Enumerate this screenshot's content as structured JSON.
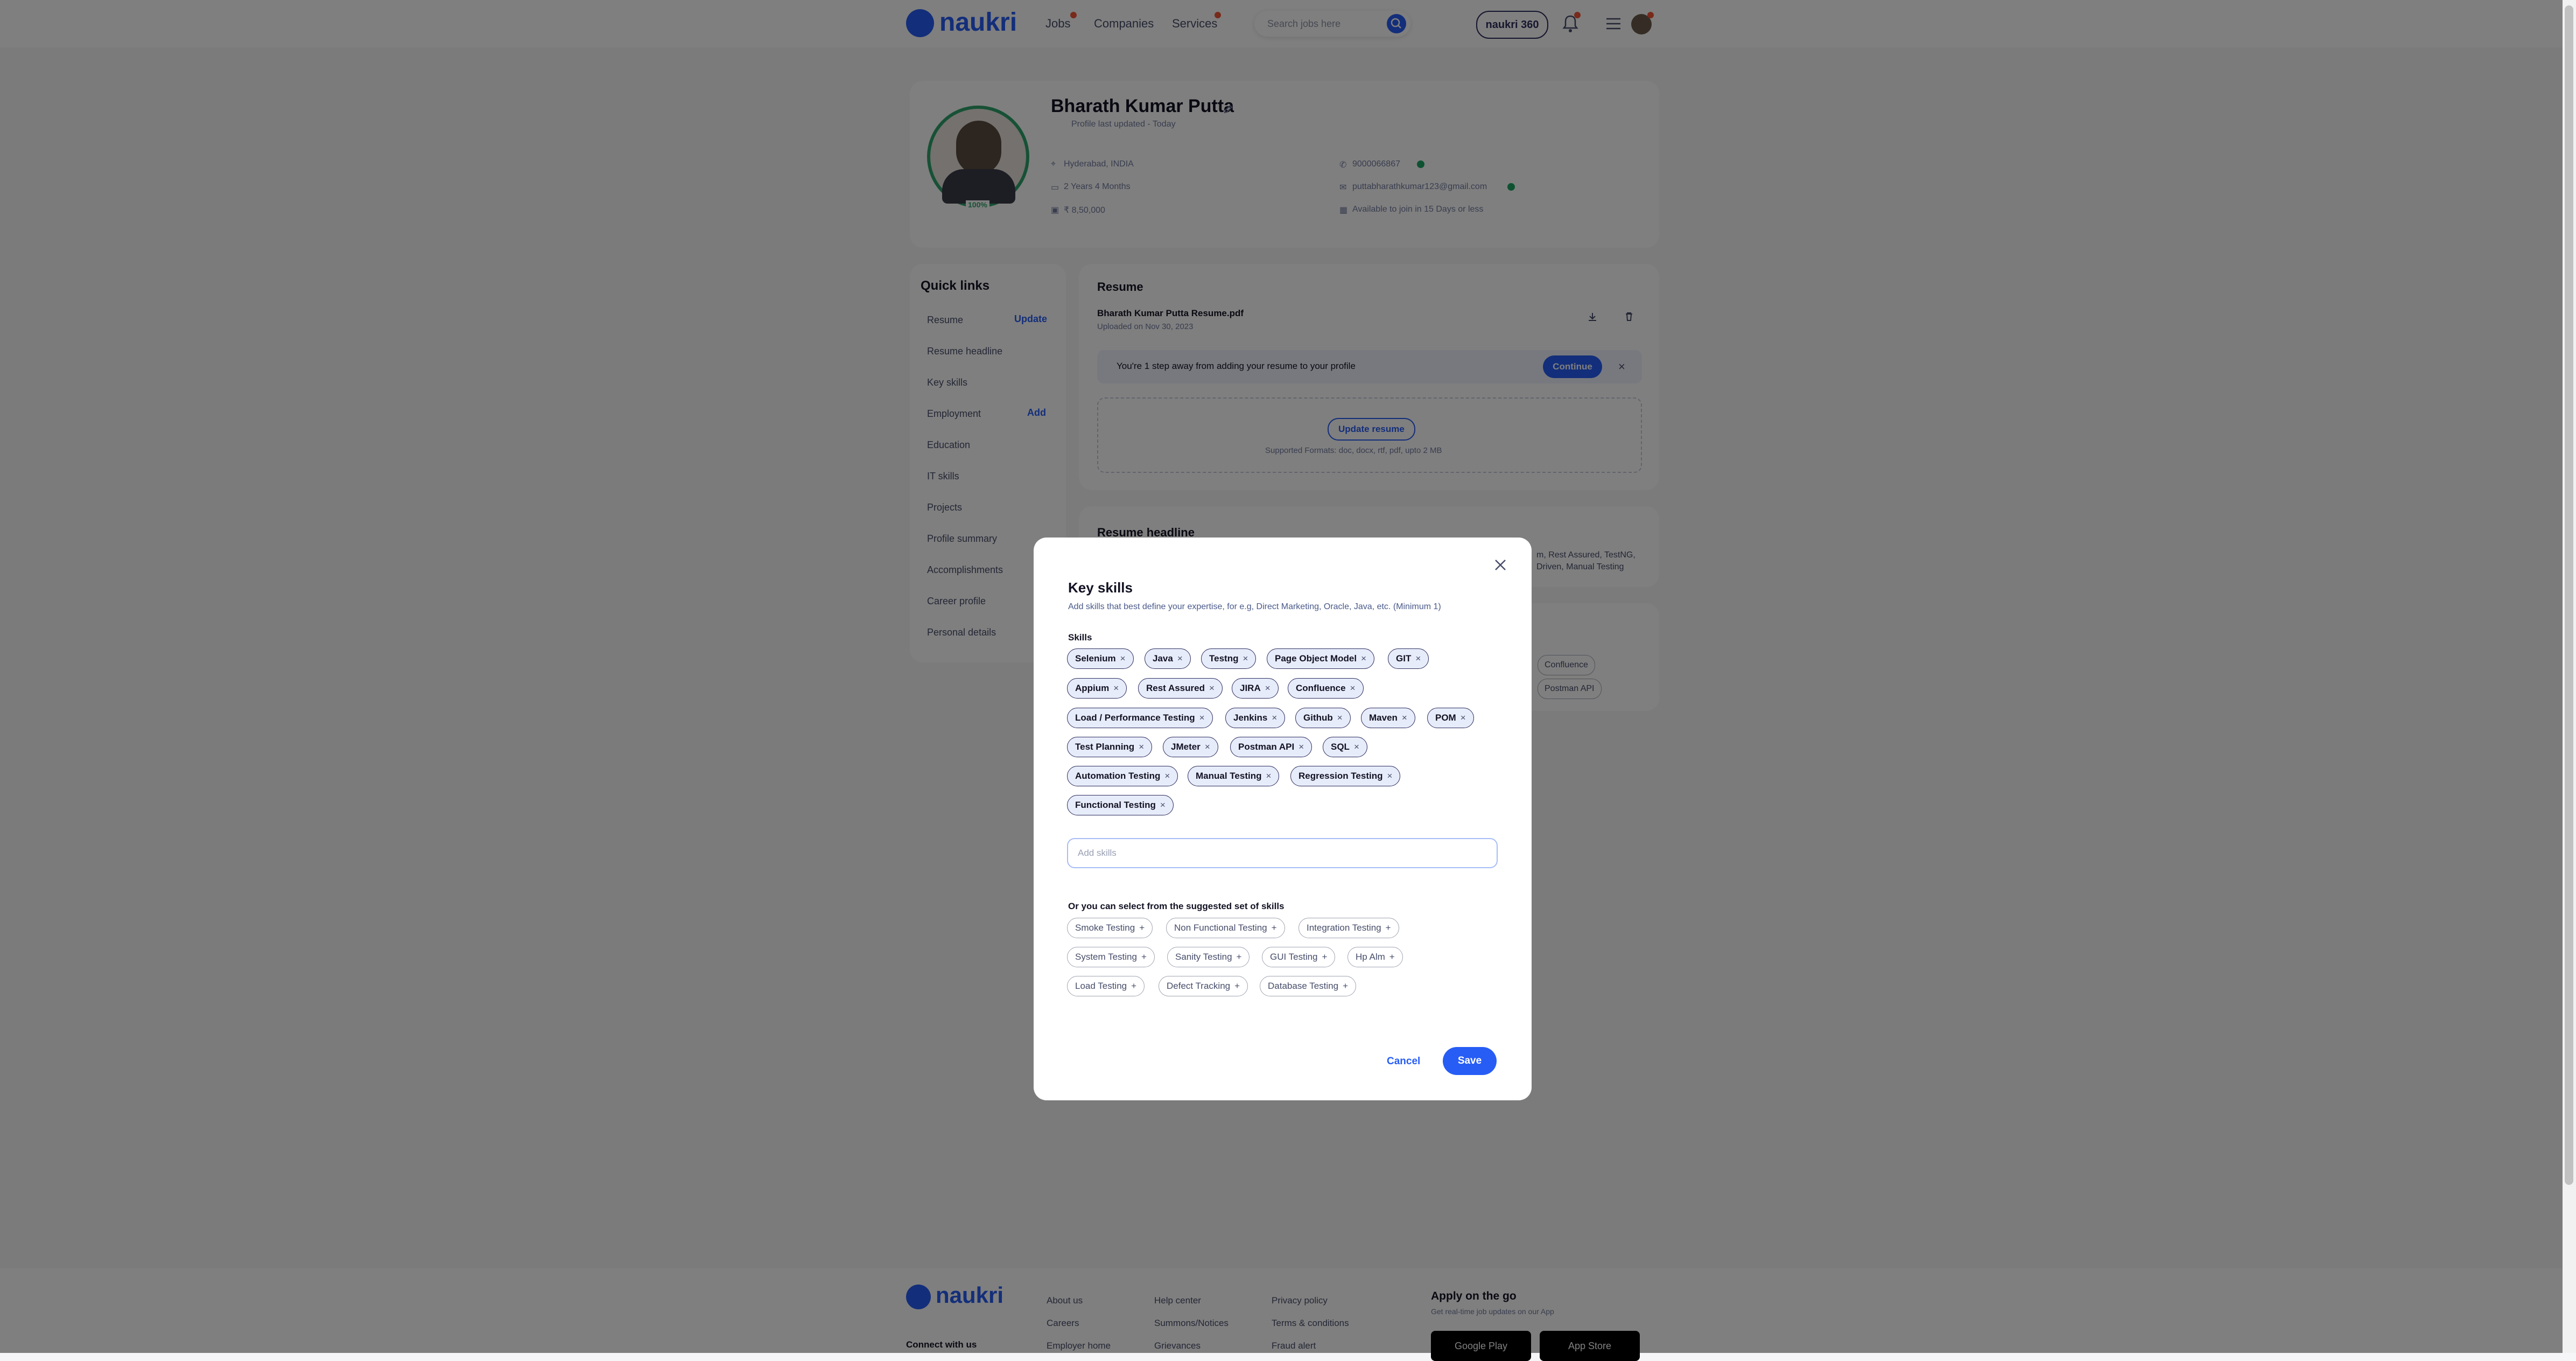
{
  "header": {
    "logo_text": "naukri",
    "nav": [
      "Jobs",
      "Companies",
      "Services"
    ],
    "search_placeholder": "Search jobs here",
    "naukri360": "naukri 360"
  },
  "profile": {
    "name": "Bharath Kumar Putta",
    "updated": "Profile last updated - Today",
    "location": "Hyderabad, INDIA",
    "experience": "2 Years 4 Months",
    "salary": "₹ 8,50,000",
    "phone": "9000066867",
    "email": "puttabharathkumar123@gmail.com",
    "availability": "Available to join in 15 Days or less",
    "completion": "100%"
  },
  "quick_links": {
    "title": "Quick links",
    "items": [
      "Resume",
      "Resume headline",
      "Key skills",
      "Employment",
      "Education",
      "IT skills",
      "Projects",
      "Profile summary",
      "Accomplishments",
      "Career profile",
      "Personal details"
    ],
    "update": "Update",
    "add": "Add"
  },
  "resume": {
    "title": "Resume",
    "file": "Bharath Kumar Putta Resume.pdf",
    "uploaded": "Uploaded on Nov 30, 2023",
    "banner": "You're 1 step away from adding your resume to your profile",
    "continue": "Continue",
    "update_btn": "Update resume",
    "formats": "Supported Formats: doc, docx, rtf, pdf, upto 2 MB"
  },
  "headline": {
    "title": "Resume headline",
    "text1": "m, Rest Assured, TestNG,",
    "text2": "Driven, Manual Testing"
  },
  "background_skills": [
    "Confluence",
    "Postman API"
  ],
  "modal": {
    "title": "Key skills",
    "subtitle": "Add skills that best define your expertise, for e.g, Direct Marketing, Oracle, Java, etc. (Minimum 1)",
    "skills_label": "Skills",
    "skills": [
      [
        "Selenium",
        "Java",
        "Testng",
        "Page Object Model",
        "GIT"
      ],
      [
        "Appium",
        "Rest Assured",
        "JIRA",
        "Confluence"
      ],
      [
        "Load / Performance Testing",
        "Jenkins",
        "Github",
        "Maven",
        "POM"
      ],
      [
        "Test Planning",
        "JMeter",
        "Postman API",
        "SQL"
      ],
      [
        "Automation Testing",
        "Manual Testing",
        "Regression Testing"
      ],
      [
        "Functional Testing"
      ]
    ],
    "add_placeholder": "Add skills",
    "suggest_label": "Or you can select from the suggested set of skills",
    "suggested": [
      [
        "Smoke Testing",
        "Non Functional Testing",
        "Integration Testing"
      ],
      [
        "System Testing",
        "Sanity Testing",
        "GUI Testing",
        "Hp Alm"
      ],
      [
        "Load Testing",
        "Defect Tracking",
        "Database Testing"
      ]
    ],
    "remove_glyph": "×",
    "add_glyph": "+",
    "cancel": "Cancel",
    "save": "Save"
  },
  "footer": {
    "logo_text": "naukri",
    "connect": "Connect with us",
    "col1": [
      "About us",
      "Careers",
      "Employer home"
    ],
    "col2": [
      "Help center",
      "Summons/Notices",
      "Grievances"
    ],
    "col3": [
      "Privacy policy",
      "Terms & conditions",
      "Fraud alert"
    ],
    "apply_title": "Apply on the go",
    "apply_sub": "Get real-time job updates on our App",
    "google_play": "Google Play",
    "app_store": "App Store"
  },
  "colors": {
    "brand": "#275df5",
    "chip_bg": "#e7ecfa",
    "overlay": "rgba(0,0,0,0.5)"
  }
}
